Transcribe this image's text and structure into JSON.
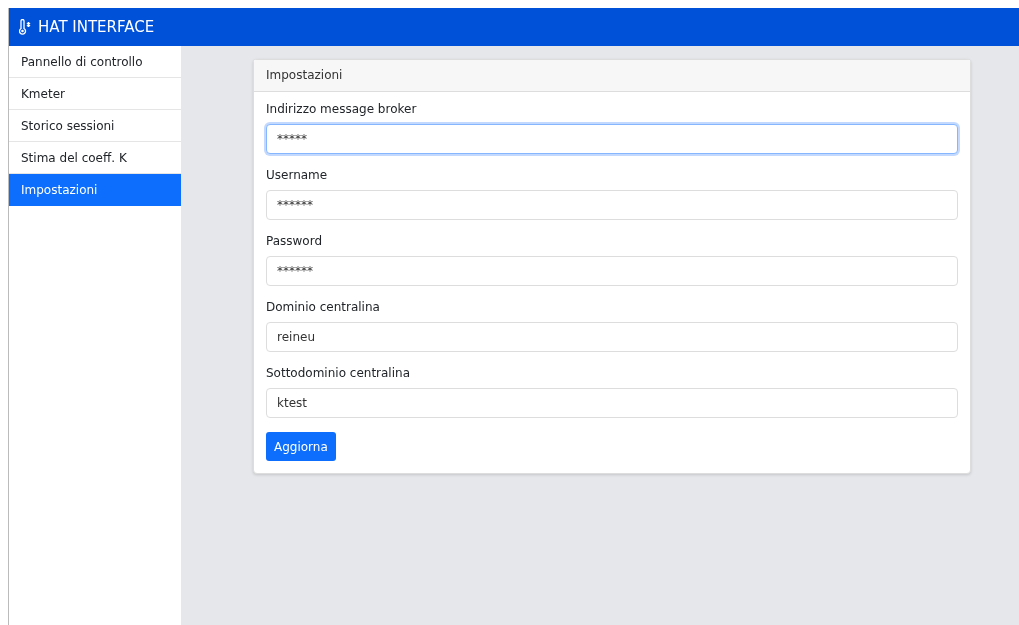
{
  "navbar": {
    "title": "HAT INTERFACE"
  },
  "sidebar": {
    "items": [
      {
        "label": "Pannello di controllo",
        "selected": false
      },
      {
        "label": "Kmeter",
        "selected": false
      },
      {
        "label": "Storico sessioni",
        "selected": false
      },
      {
        "label": "Stima del coeff. K",
        "selected": false
      },
      {
        "label": "Impostazioni",
        "selected": true
      }
    ]
  },
  "card": {
    "title": "Impostazioni",
    "fields": [
      {
        "label": "Indirizzo message broker",
        "value": "*****",
        "focused": true
      },
      {
        "label": "Username",
        "value": "******",
        "focused": false
      },
      {
        "label": "Password",
        "value": "******",
        "focused": false
      },
      {
        "label": "Dominio centralina",
        "value": "reineu",
        "focused": false
      },
      {
        "label": "Sottodominio centralina",
        "value": "ktest",
        "focused": false
      }
    ],
    "button": "Aggiorna"
  }
}
